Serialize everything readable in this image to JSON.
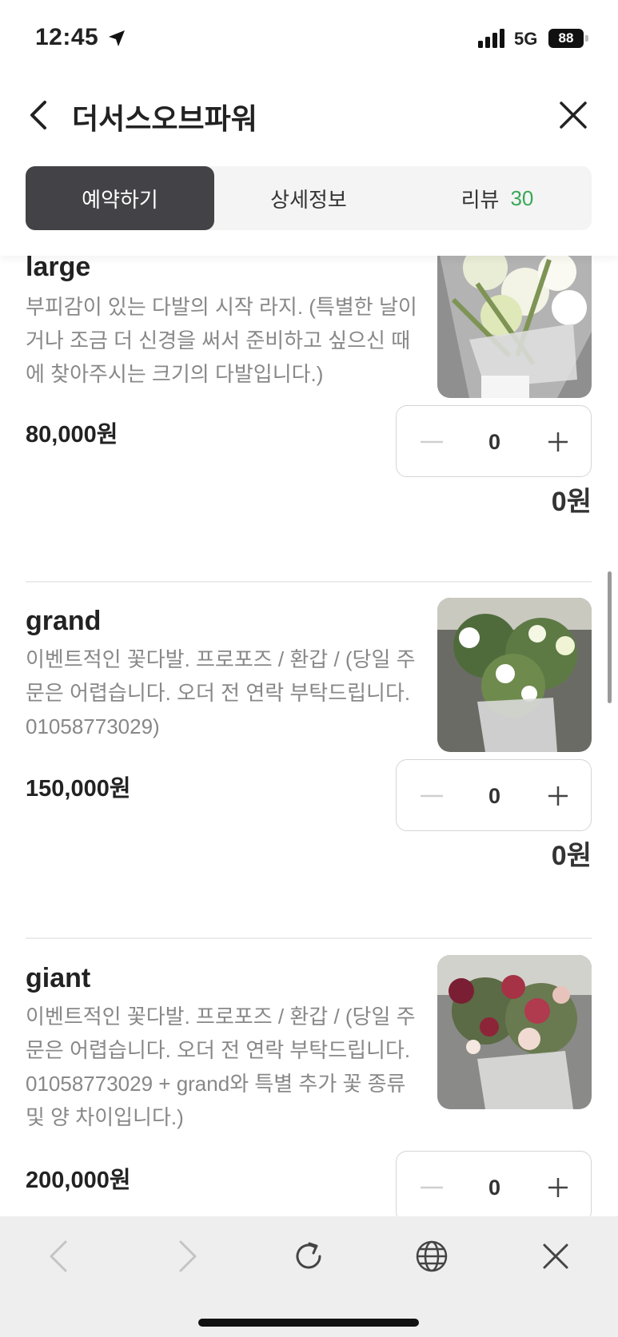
{
  "status_bar": {
    "time": "12:45",
    "network": "5G",
    "battery": "88"
  },
  "header": {
    "title": "더서스오브파워"
  },
  "tabs": [
    {
      "label": "예약하기",
      "count": ""
    },
    {
      "label": "상세정보",
      "count": ""
    },
    {
      "label": "리뷰",
      "count": "30"
    }
  ],
  "items": [
    {
      "name": "large",
      "description": "부피감이 있는 다발의 시작 라지. (특별한 날이거나 조금 더 신경을 써서 준비하고 싶으신 때에 찾아주시는 크기의 다발입니다.)",
      "price": "80,000원",
      "quantity": "0",
      "total": "0원",
      "thumb_colors": [
        "#d8d8c8",
        "#eef3d8",
        "#a6b57e"
      ]
    },
    {
      "name": "grand",
      "description": "이벤트적인 꽃다발. 프로포즈 / 환갑 / (당일 주문은 어렵습니다. 오더 전 연락 부탁드립니다. 01058773029)",
      "price": "150,000원",
      "quantity": "0",
      "total": "0원",
      "thumb_colors": [
        "#7b8b64",
        "#eef0d8",
        "#4c6a3a"
      ]
    },
    {
      "name": "giant",
      "description": "이벤트적인 꽃다발. 프로포즈 / 환갑 / (당일 주문은 어렵습니다. 오더 전 연락 부탁드립니다. 01058773029 + grand와 특별 추가 꽃 종류 및 양 차이입니다.)",
      "price": "200,000원",
      "quantity": "0",
      "total": "",
      "thumb_colors": [
        "#8a3a48",
        "#e9d6d0",
        "#5c6f47"
      ]
    }
  ],
  "colors": {
    "active_tab": "#434347",
    "review_count": "#3aa857"
  }
}
